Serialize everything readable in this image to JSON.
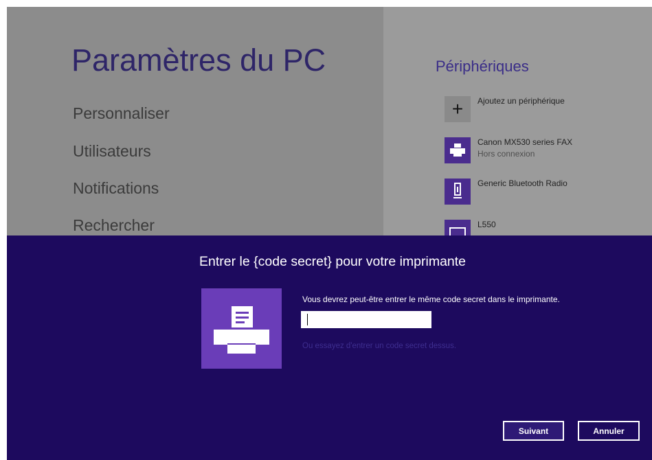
{
  "settings": {
    "title": "Paramètres du PC",
    "nav": [
      "Personnaliser",
      "Utilisateurs",
      "Notifications",
      "Rechercher"
    ]
  },
  "devices": {
    "section_title": "Périphériques",
    "add_label": "Ajoutez un périphérique",
    "items": [
      {
        "name": "Canon MX530 series FAX",
        "status": "Hors connexion",
        "icon": "printer-icon"
      },
      {
        "name": "Generic Bluetooth Radio",
        "icon": "bluetooth-radio-icon"
      },
      {
        "name": "L550",
        "icon": "monitor-icon"
      }
    ]
  },
  "dialog": {
    "title": "Entrer le {code secret} pour votre imprimante",
    "instruction": "Vous devrez peut-être entrer le même code secret dans le imprimante.",
    "pin_value": "",
    "alt_link": "Ou essayez d'entrer un code secret dessus.",
    "next_label": "Suivant",
    "cancel_label": "Annuler",
    "icon": "printer-icon"
  },
  "colors": {
    "dialog_bg": "#1d0a5e",
    "tile_purple": "#6a3db8",
    "device_tile": "#4a2c8e"
  }
}
